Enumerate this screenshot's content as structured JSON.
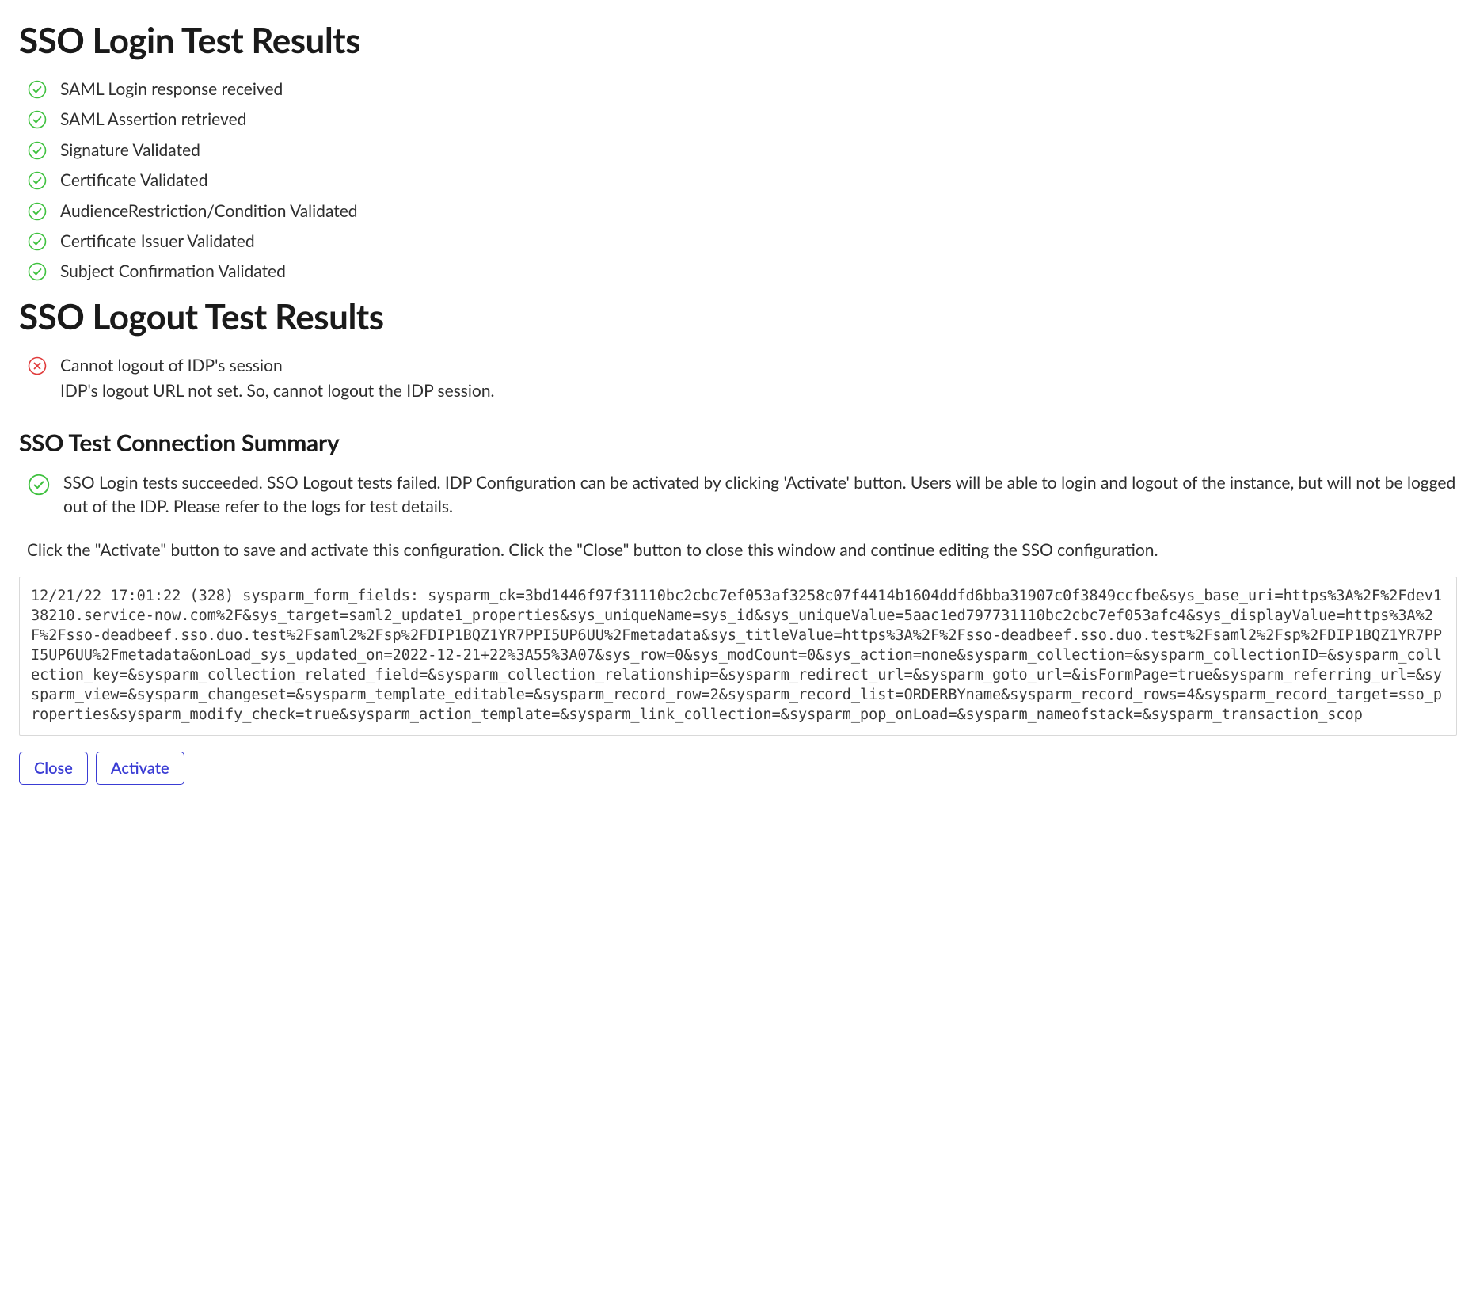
{
  "login_section": {
    "title": "SSO Login Test Results",
    "items": [
      {
        "status": "success",
        "label": "SAML Login response received"
      },
      {
        "status": "success",
        "label": "SAML Assertion retrieved"
      },
      {
        "status": "success",
        "label": "Signature Validated"
      },
      {
        "status": "success",
        "label": "Certificate Validated"
      },
      {
        "status": "success",
        "label": "AudienceRestriction/Condition Validated"
      },
      {
        "status": "success",
        "label": "Certificate Issuer Validated"
      },
      {
        "status": "success",
        "label": "Subject Confirmation Validated"
      }
    ]
  },
  "logout_section": {
    "title": "SSO Logout Test Results",
    "items": [
      {
        "status": "error",
        "label": "Cannot logout of IDP's session",
        "detail": "IDP's logout URL not set. So, cannot logout the IDP session."
      }
    ]
  },
  "summary_section": {
    "title": "SSO Test Connection Summary",
    "status": "success",
    "text": "SSO Login tests succeeded. SSO Logout tests failed. IDP Configuration can be activated by clicking 'Activate' button. Users will be able to login and logout of the instance, but will not be logged out of the IDP. Please refer to the logs for test details.",
    "note": "Click the \"Activate\" button to save and activate this configuration. Click the \"Close\" button to close this window and continue editing the SSO configuration."
  },
  "log_text": "12/21/22 17:01:22 (328) sysparm_form_fields: sysparm_ck=3bd1446f97f31110bc2cbc7ef053af3258c07f4414b1604ddfd6bba31907c0f3849ccfbe&sys_base_uri=https%3A%2F%2Fdev138210.service-now.com%2F&sys_target=saml2_update1_properties&sys_uniqueName=sys_id&sys_uniqueValue=5aac1ed797731110bc2cbc7ef053afc4&sys_displayValue=https%3A%2F%2Fsso-deadbeef.sso.duo.test%2Fsaml2%2Fsp%2FDIP1BQZ1YR7PPI5UP6UU%2Fmetadata&sys_titleValue=https%3A%2F%2Fsso-deadbeef.sso.duo.test%2Fsaml2%2Fsp%2FDIP1BQZ1YR7PPI5UP6UU%2Fmetadata&onLoad_sys_updated_on=2022-12-21+22%3A55%3A07&sys_row=0&sys_modCount=0&sys_action=none&sysparm_collection=&sysparm_collectionID=&sysparm_collection_key=&sysparm_collection_related_field=&sysparm_collection_relationship=&sysparm_redirect_url=&sysparm_goto_url=&isFormPage=true&sysparm_referring_url=&sysparm_view=&sysparm_changeset=&sysparm_template_editable=&sysparm_record_row=2&sysparm_record_list=ORDERBYname&sysparm_record_rows=4&sysparm_record_target=sso_properties&sysparm_modify_check=true&sysparm_action_template=&sysparm_link_collection=&sysparm_pop_onLoad=&sysparm_nameofstack=&sysparm_transaction_scop",
  "buttons": {
    "close": "Close",
    "activate": "Activate"
  },
  "colors": {
    "success": "#3fc13f",
    "error": "#e03a3a",
    "button_border": "#3a3cd4"
  }
}
